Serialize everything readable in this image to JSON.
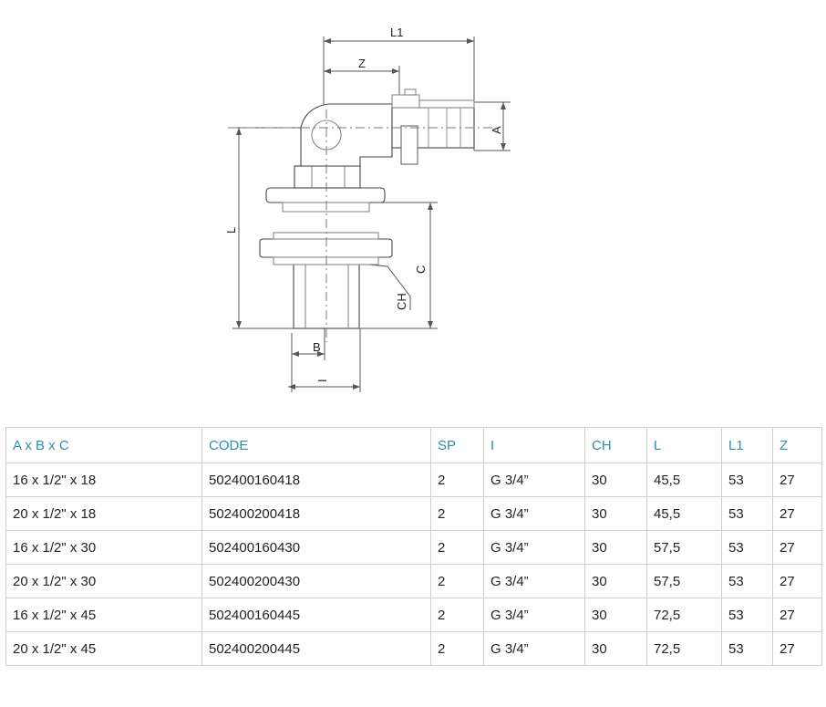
{
  "drawing": {
    "labels": {
      "l1": "L1",
      "z": "Z",
      "a": "A",
      "l": "L",
      "c": "C",
      "ch": "CH",
      "b": "B",
      "i": "I"
    }
  },
  "table": {
    "headers": [
      "A x B x C",
      "CODE",
      "SP",
      "I",
      "CH",
      "L",
      "L1",
      "Z"
    ],
    "rows": [
      [
        "16 x 1/2\" x 18",
        "502400160418",
        "2",
        "G 3/4”",
        "30",
        "45,5",
        "53",
        "27"
      ],
      [
        "20 x 1/2\" x 18",
        "502400200418",
        "2",
        "G 3/4”",
        "30",
        "45,5",
        "53",
        "27"
      ],
      [
        "16 x 1/2\" x 30",
        "502400160430",
        "2",
        "G 3/4”",
        "30",
        "57,5",
        "53",
        "27"
      ],
      [
        "20 x 1/2\" x 30",
        "502400200430",
        "2",
        "G 3/4”",
        "30",
        "57,5",
        "53",
        "27"
      ],
      [
        "16 x 1/2\" x 45",
        "502400160445",
        "2",
        "G 3/4”",
        "30",
        "72,5",
        "53",
        "27"
      ],
      [
        "20 x 1/2\" x 45",
        "502400200445",
        "2",
        "G 3/4”",
        "30",
        "72,5",
        "53",
        "27"
      ]
    ]
  }
}
